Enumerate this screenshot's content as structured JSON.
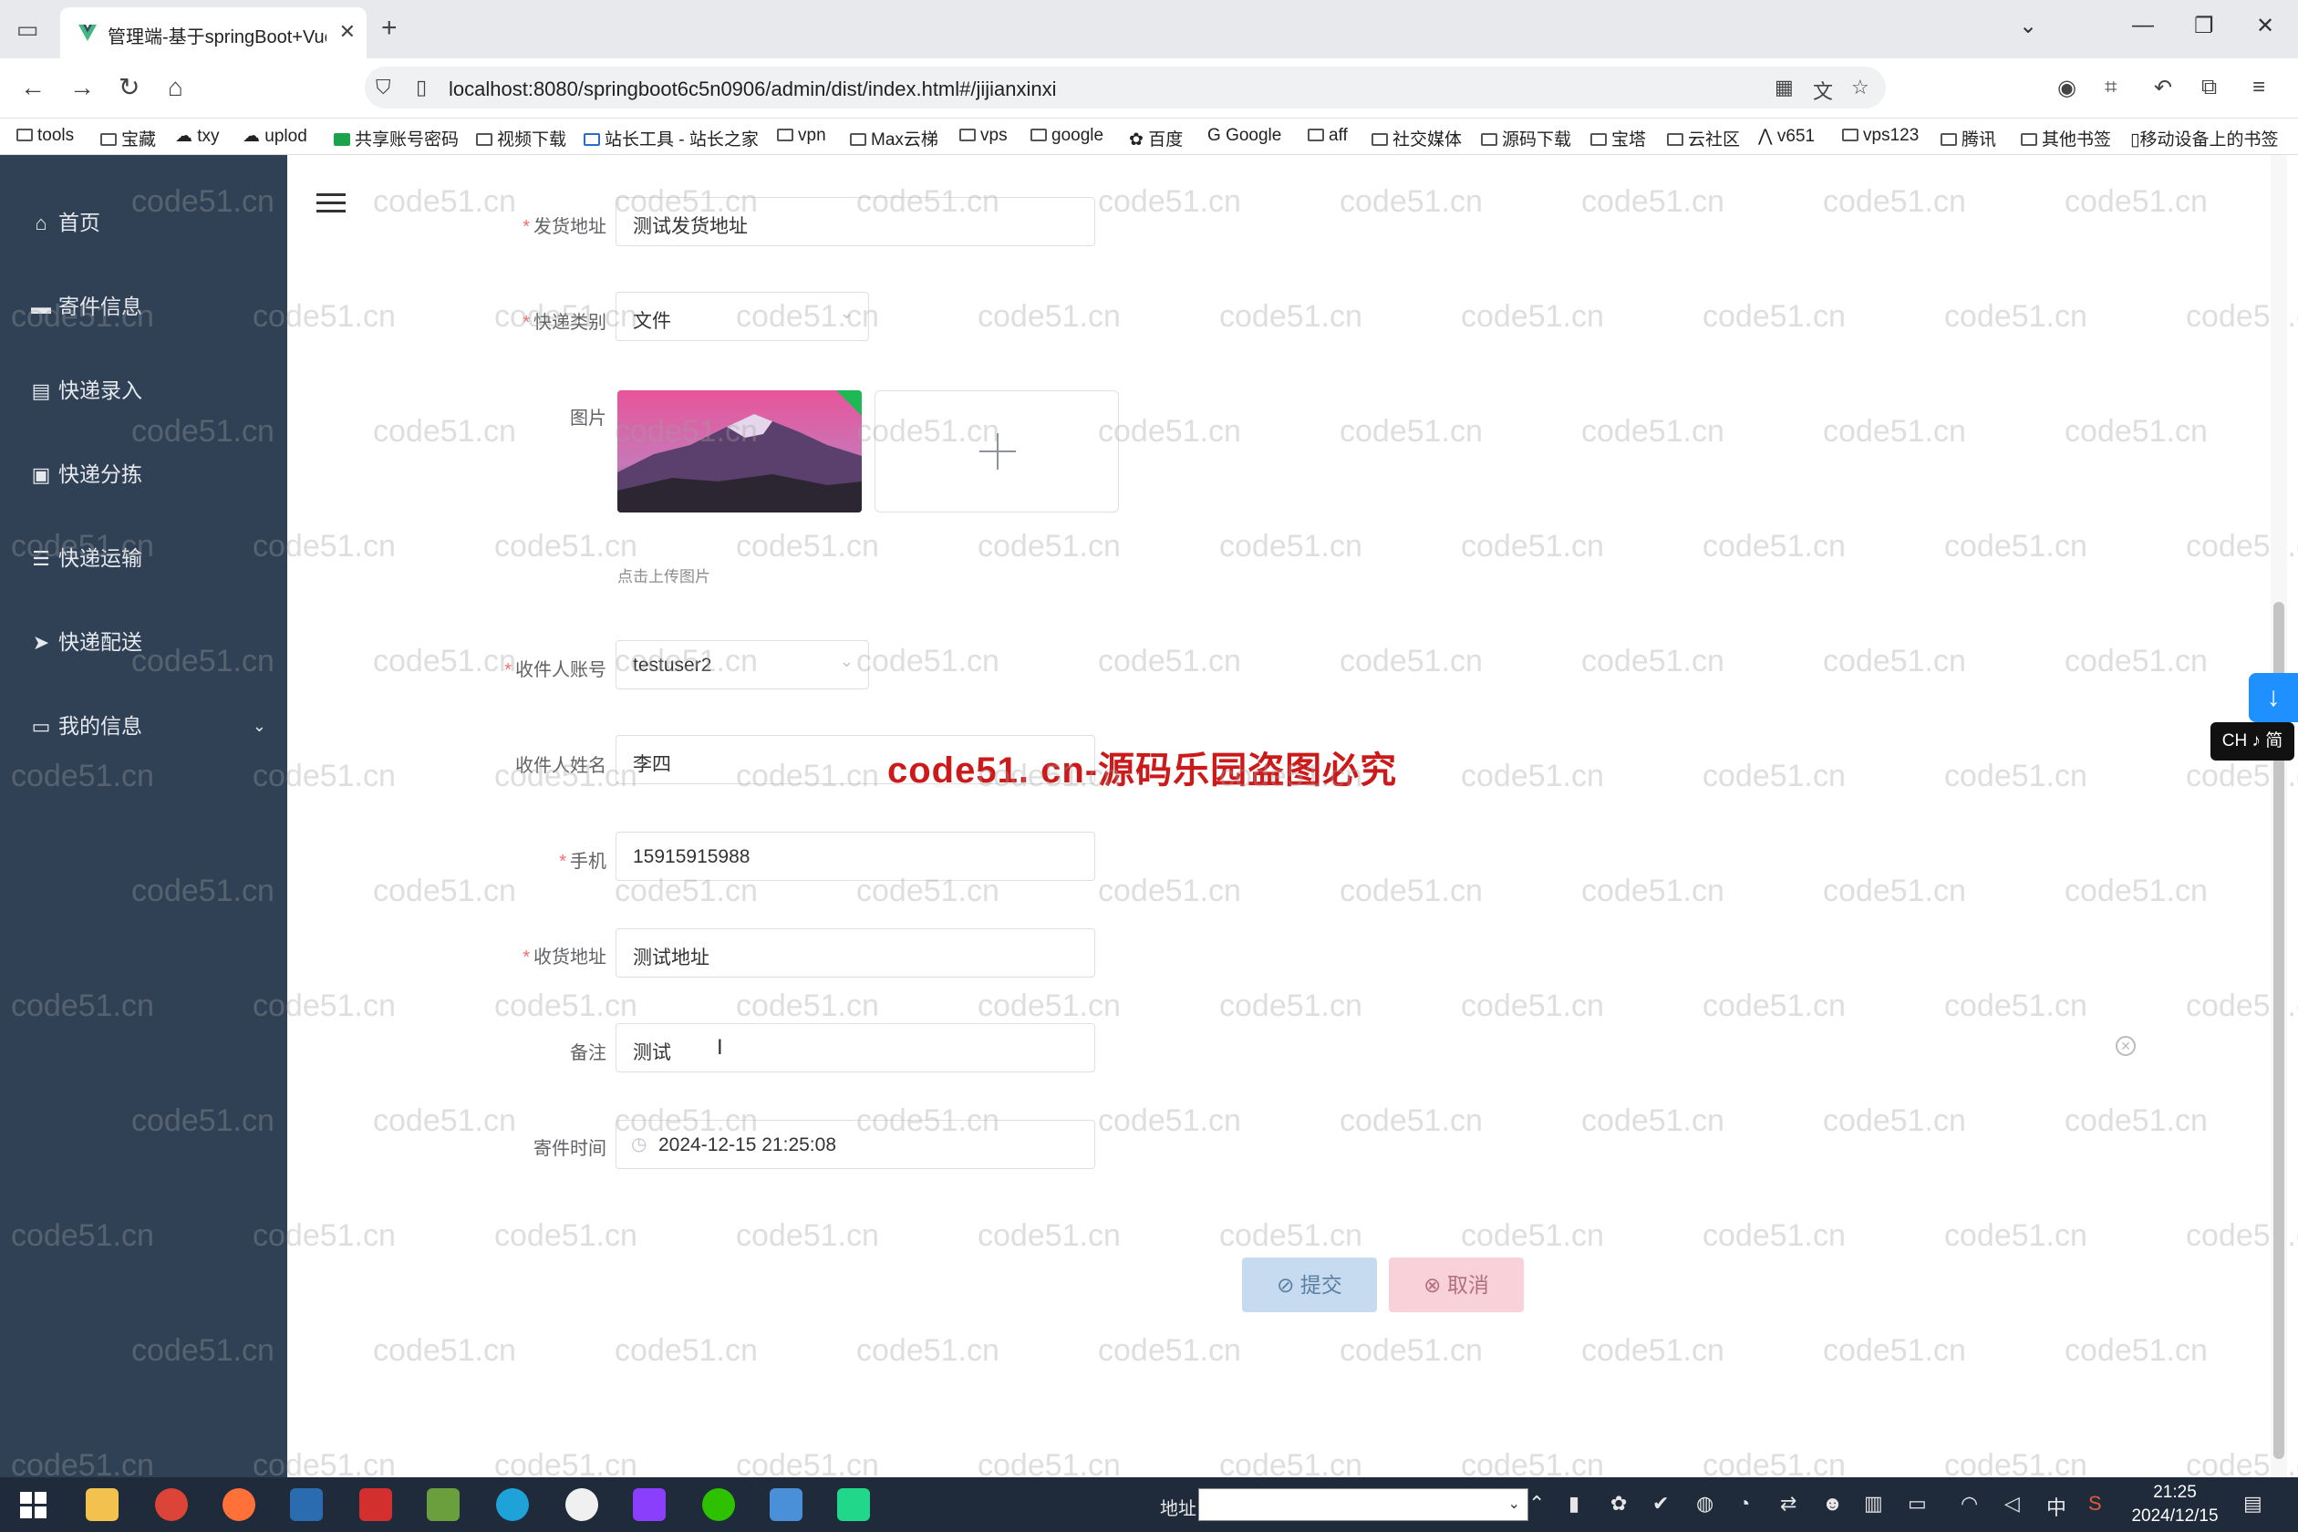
{
  "browser": {
    "tab_title": "管理端-基于springBoot+Vue的",
    "url": "localhost:8080/springboot6c5n0906/admin/dist/index.html#/jijianxinxi",
    "bookmarks": [
      "tools",
      "宝藏",
      "txy",
      "uplod",
      "共享账号密码",
      "视频下载",
      "站长工具 - 站长之家",
      "vpn",
      "Max云梯",
      "vps",
      "google",
      "百度",
      "Google",
      "aff",
      "社交媒体",
      "源码下载",
      "宝塔",
      "云社区",
      "v651",
      "vps123",
      "腾讯",
      "其他书签",
      "移动设备上的书签"
    ]
  },
  "sidebar": {
    "items": [
      {
        "label": "首页",
        "icon": "home-icon"
      },
      {
        "label": "寄件信息",
        "icon": "monitor-icon"
      },
      {
        "label": "快递录入",
        "icon": "clipboard-icon"
      },
      {
        "label": "快递分拣",
        "icon": "briefcase-icon"
      },
      {
        "label": "快递运输",
        "icon": "list-icon"
      },
      {
        "label": "快递配送",
        "icon": "send-icon"
      },
      {
        "label": "我的信息",
        "icon": "profile-icon"
      }
    ]
  },
  "form": {
    "sender_address": {
      "label": "发货地址",
      "value": "测试发货地址"
    },
    "express_type": {
      "label": "快递类别",
      "value": "文件"
    },
    "image": {
      "label": "图片",
      "hint": "点击上传图片"
    },
    "receiver_account": {
      "label": "收件人账号",
      "value": "testuser2"
    },
    "receiver_name": {
      "label": "收件人姓名",
      "value": "李四"
    },
    "phone": {
      "label": "手机",
      "value": "15915915988"
    },
    "receiver_address": {
      "label": "收货地址",
      "value": "测试地址"
    },
    "remark": {
      "label": "备注",
      "value": "测试"
    },
    "send_time": {
      "label": "寄件时间",
      "value": "2024-12-15 21:25:08"
    },
    "submit_label": "提交",
    "cancel_label": "取消"
  },
  "overlay": {
    "warning_text": "code51. cn-源码乐园盗图必究",
    "watermark": "code51.cn",
    "ime_label": "CH ♪ 简"
  },
  "taskbar": {
    "address_label": "地址",
    "time": "21:25",
    "date": "2024/12/15",
    "lang": "中"
  },
  "colors": {
    "sidebar_bg": "#304156",
    "required_mark": "#f56c6c",
    "warning_text": "#cc1a1a"
  }
}
